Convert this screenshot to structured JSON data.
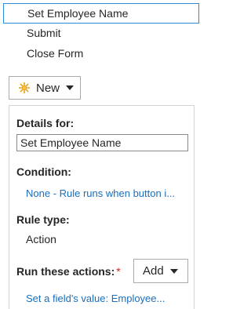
{
  "rules": [
    {
      "label": "Set Employee Name"
    },
    {
      "label": "Submit"
    },
    {
      "label": "Close Form"
    }
  ],
  "toolbar": {
    "new_label": "New"
  },
  "details": {
    "heading": "Details for:",
    "name_value": "Set Employee Name",
    "condition_heading": "Condition:",
    "condition_link": "None - Rule runs when button i...",
    "rule_type_heading": "Rule type:",
    "rule_type_value": "Action",
    "actions_heading": "Run these actions:",
    "required_marker": "*",
    "add_label": "Add",
    "action_link": "Set a field's value: Employee..."
  },
  "colors": {
    "selection_border": "#2d8bd9",
    "link": "#1a6fbf",
    "required": "#e0191a",
    "star": "#e8a21c"
  }
}
